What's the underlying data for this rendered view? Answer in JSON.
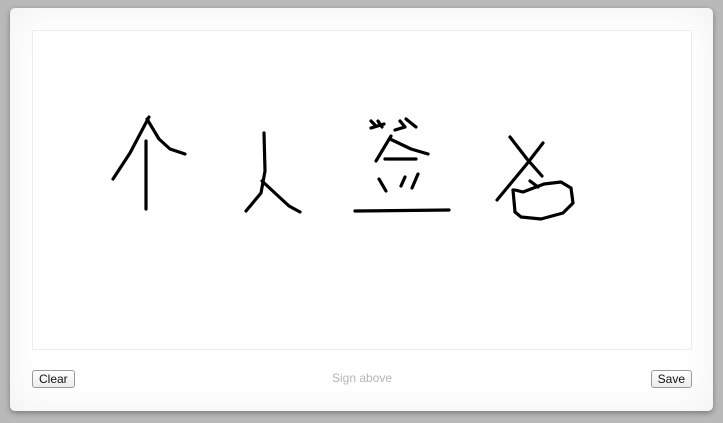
{
  "signature_pad": {
    "canvas_name": "signature-canvas",
    "stroke_color": "#000000",
    "background_color": "#ffffff"
  },
  "footer": {
    "clear_label": "Clear",
    "hint_text": "Sign above",
    "save_label": "Save"
  },
  "colors": {
    "page_background": "#b9b9b9",
    "hint_text": "#b5b5b5"
  }
}
